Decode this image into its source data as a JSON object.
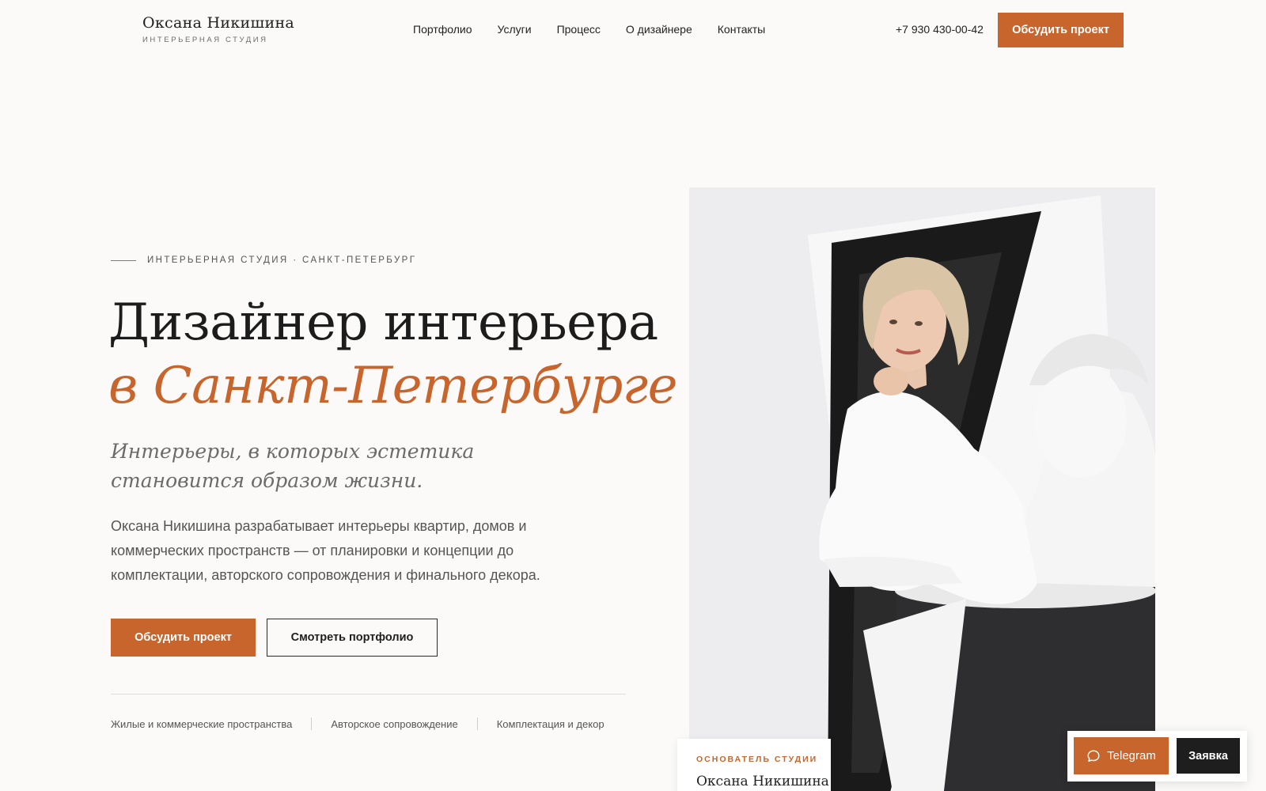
{
  "header": {
    "logo_name": "Оксана Никишина",
    "logo_sub": "ИНТЕРЬЕРНАЯ СТУДИЯ",
    "nav": [
      "Портфолио",
      "Услуги",
      "Процесс",
      "О дизайнере",
      "Контакты"
    ],
    "phone": "+7 930 430-00-42",
    "cta": "Обсудить проект"
  },
  "hero": {
    "eyebrow": "ИНТЕРЬЕРНАЯ СТУДИЯ · САНКТ-ПЕТЕРБУРГ",
    "title_line1": "Дизайнер интерьера",
    "title_line2": "в Санкт-Петербурге",
    "lead": "Интерьеры, в которых эстетика становится образом жизни.",
    "description": "Оксана Никишина разрабатывает интерьеры квартир, домов и коммерческих пространств — от планировки и концепции до комплектации, авторского сопровождения и финального декора.",
    "primary_button": "Обсудить проект",
    "secondary_button": "Смотреть портфолио",
    "tags": [
      "Жилые и коммерческие пространства",
      "Авторское сопровождение",
      "Комплектация и декор"
    ]
  },
  "founder_card": {
    "label": "ОСНОВАТЕЛЬ СТУДИИ",
    "name": "Оксана Никишина"
  },
  "widget": {
    "telegram": "Telegram",
    "request": "Заявка"
  },
  "colors": {
    "accent": "#c8652c",
    "background": "#fbfaf8",
    "dark": "#1e1e1e"
  },
  "icons": {
    "telegram_button": "chat-bubble-icon"
  }
}
